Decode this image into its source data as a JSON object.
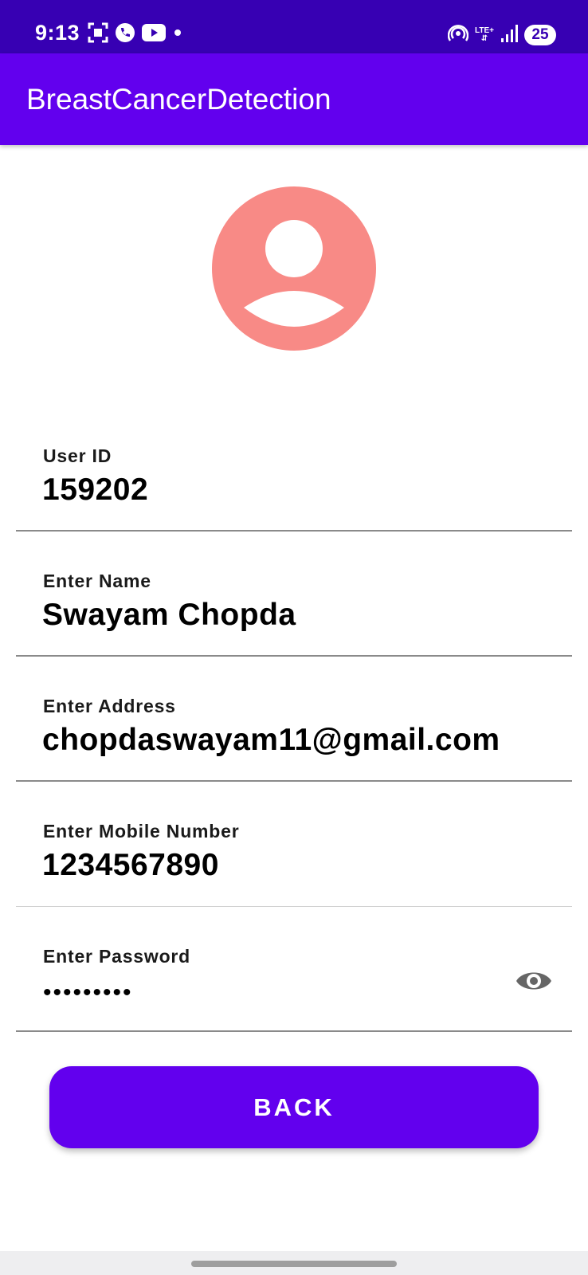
{
  "status_bar": {
    "time": "9:13",
    "network_label": "LTE+",
    "battery_level": "25",
    "left_icons": [
      "screenshot-icon",
      "phone-app-icon",
      "youtube-icon",
      "notification-dot-icon"
    ],
    "right_icons": [
      "hotspot-icon",
      "lte-signal-icon",
      "cell-signal-icon",
      "battery-icon"
    ]
  },
  "app_bar": {
    "title": "BreastCancerDetection"
  },
  "profile": {
    "avatar_icon": "person-avatar-icon",
    "avatar_color": "#f88a86"
  },
  "form": {
    "user_id": {
      "label": "User ID",
      "value": "159202"
    },
    "name": {
      "label": "Enter Name",
      "value": "Swayam Chopda"
    },
    "address": {
      "label": "Enter Address",
      "value": "chopdaswayam11@gmail.com"
    },
    "mobile": {
      "label": "Enter Mobile Number",
      "value": "1234567890"
    },
    "password": {
      "label": "Enter Password",
      "value": "•••••••••",
      "toggle_icon": "eye-icon"
    }
  },
  "actions": {
    "back_label": "BACK"
  },
  "colors": {
    "status_bar": "#3700b3",
    "primary": "#6200ee",
    "avatar": "#f88a86"
  }
}
